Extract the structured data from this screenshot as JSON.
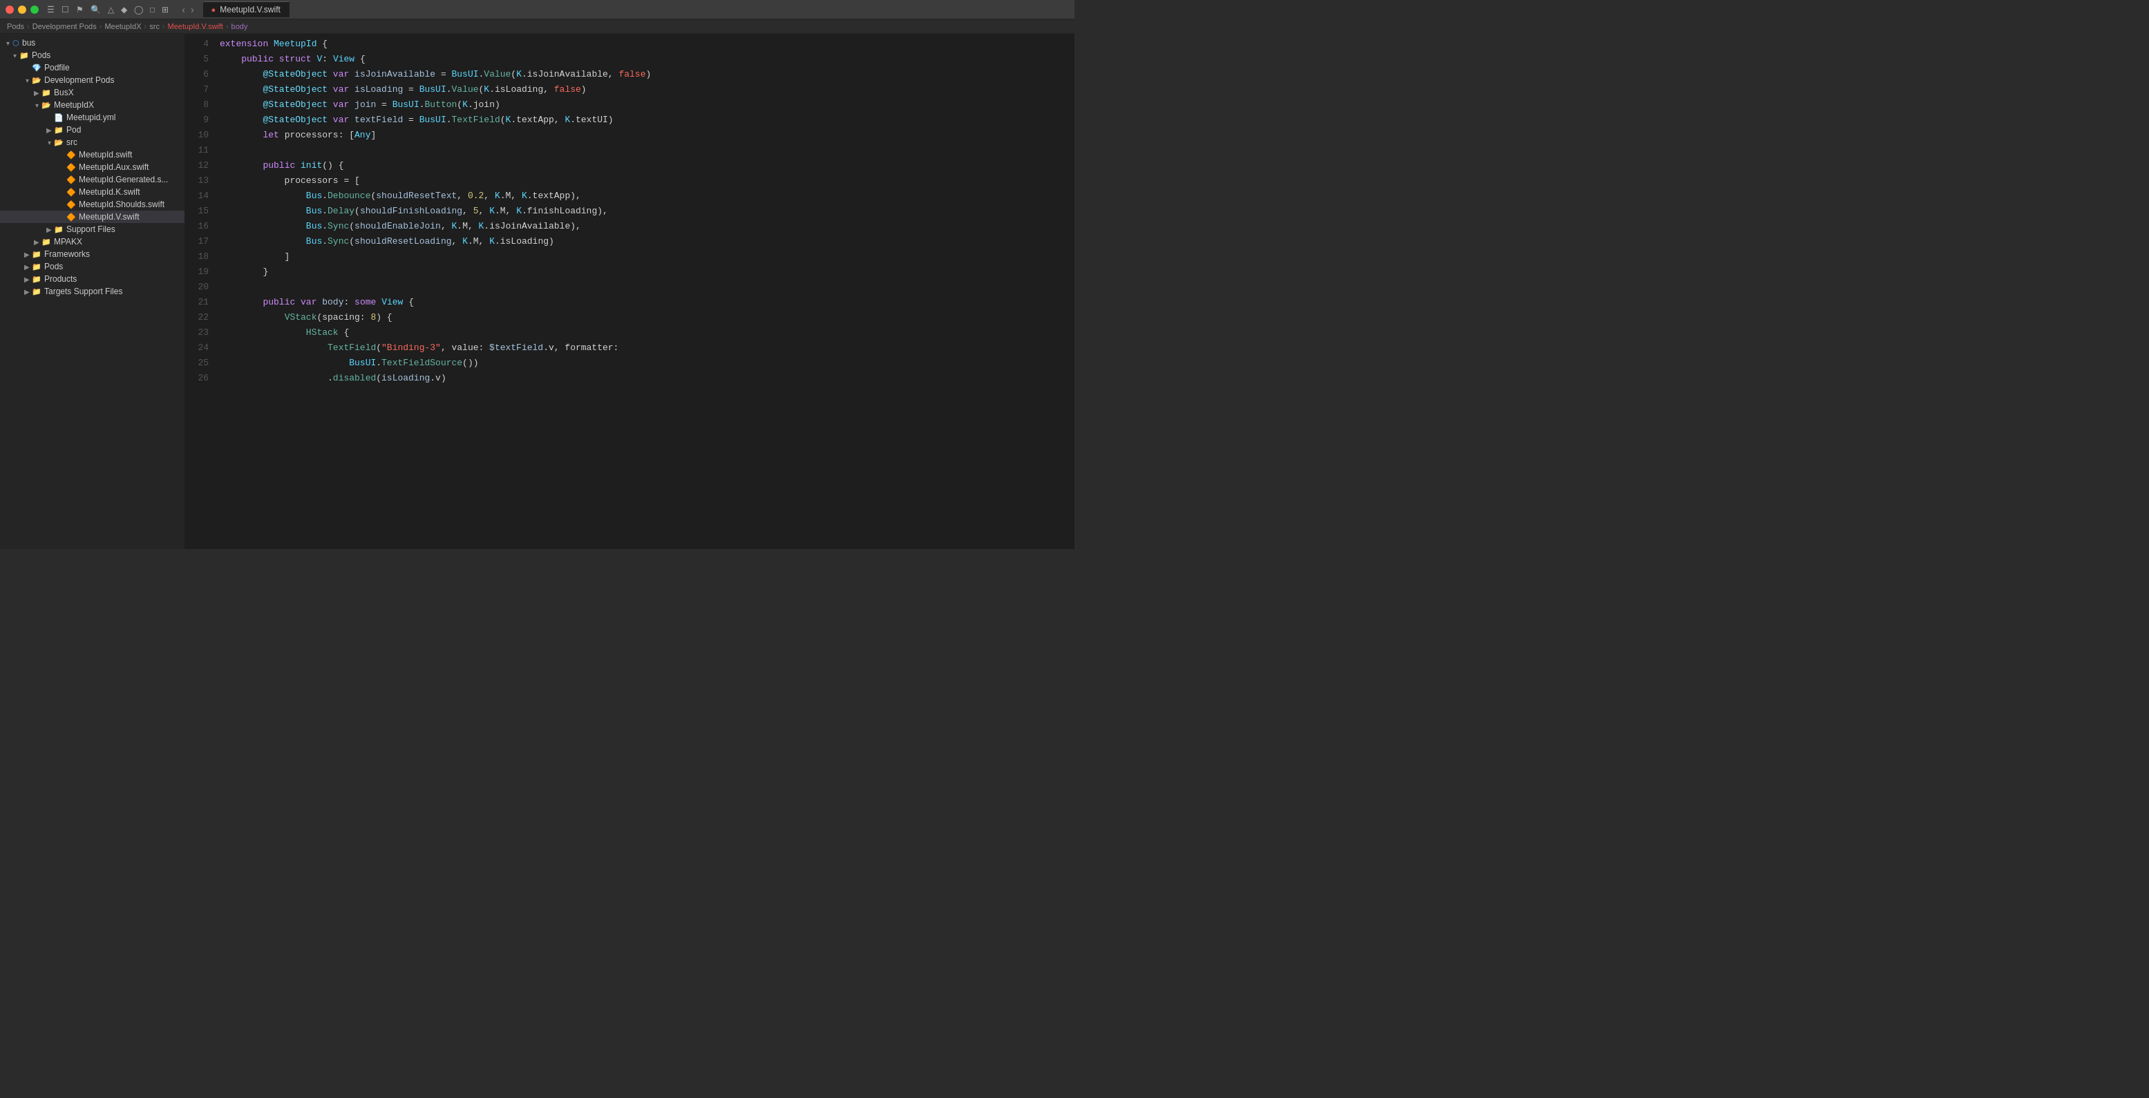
{
  "titlebar": {
    "tab_label": "MeetupId.V.swift",
    "traffic_lights": [
      "close",
      "minimize",
      "maximize"
    ]
  },
  "breadcrumb": {
    "items": [
      "Pods",
      "Development Pods",
      "MeetupIdX",
      "src",
      "MeetupId.V.swift",
      "body"
    ]
  },
  "sidebar": {
    "items": [
      {
        "id": "bus",
        "label": "bus",
        "indent": 0,
        "type": "project",
        "icon": "project",
        "expanded": true
      },
      {
        "id": "pods",
        "label": "Pods",
        "indent": 1,
        "type": "group",
        "icon": "folder-blue",
        "expanded": true
      },
      {
        "id": "podfile",
        "label": "Podfile",
        "indent": 2,
        "type": "file",
        "icon": "ruby"
      },
      {
        "id": "devpods",
        "label": "Development Pods",
        "indent": 2,
        "type": "group",
        "icon": "folder",
        "expanded": true
      },
      {
        "id": "busx",
        "label": "BusX",
        "indent": 3,
        "type": "group",
        "icon": "folder",
        "expanded": false
      },
      {
        "id": "meetupidx",
        "label": "MeetupIdX",
        "indent": 3,
        "type": "group",
        "icon": "folder",
        "expanded": true
      },
      {
        "id": "meetupidyml",
        "label": "Meetupid.yml",
        "indent": 4,
        "type": "file",
        "icon": "yaml"
      },
      {
        "id": "pod",
        "label": "Pod",
        "indent": 4,
        "type": "group",
        "icon": "folder",
        "expanded": false
      },
      {
        "id": "src",
        "label": "src",
        "indent": 4,
        "type": "group",
        "icon": "folder",
        "expanded": true
      },
      {
        "id": "meetupid-swift",
        "label": "MeetupId.swift",
        "indent": 5,
        "type": "swift",
        "icon": "swift"
      },
      {
        "id": "meetupid-aux",
        "label": "MeetupId.Aux.swift",
        "indent": 5,
        "type": "swift",
        "icon": "swift"
      },
      {
        "id": "meetupid-gen",
        "label": "MeetupId.Generated.s...",
        "indent": 5,
        "type": "swift",
        "icon": "swift"
      },
      {
        "id": "meetupid-k",
        "label": "MeetupId.K.swift",
        "indent": 5,
        "type": "swift",
        "icon": "swift"
      },
      {
        "id": "meetupid-shoulds",
        "label": "MeetupId.Shoulds.swift",
        "indent": 5,
        "type": "swift",
        "icon": "swift"
      },
      {
        "id": "meetupid-v",
        "label": "MeetupId.V.swift",
        "indent": 5,
        "type": "swift",
        "icon": "swift",
        "selected": true
      },
      {
        "id": "support-files",
        "label": "Support Files",
        "indent": 4,
        "type": "group",
        "icon": "folder",
        "expanded": false
      },
      {
        "id": "mpakx",
        "label": "MPAKX",
        "indent": 3,
        "type": "group",
        "icon": "folder",
        "expanded": false
      },
      {
        "id": "frameworks",
        "label": "Frameworks",
        "indent": 2,
        "type": "group",
        "icon": "folder",
        "expanded": false
      },
      {
        "id": "pods-group",
        "label": "Pods",
        "indent": 2,
        "type": "group",
        "icon": "folder",
        "expanded": false
      },
      {
        "id": "products",
        "label": "Products",
        "indent": 2,
        "type": "group",
        "icon": "folder",
        "expanded": false
      },
      {
        "id": "targets-support",
        "label": "Targets Support Files",
        "indent": 2,
        "type": "group",
        "icon": "folder",
        "expanded": false
      }
    ]
  },
  "editor": {
    "filename": "MeetupId.V.swift",
    "lines": [
      {
        "num": 4,
        "code": "extension MeetupId {"
      },
      {
        "num": 5,
        "code": "    public struct V: View {"
      },
      {
        "num": 6,
        "code": "        @StateObject var isJoinAvailable = BusUI.Value(K.isJoinAvailable, false)"
      },
      {
        "num": 7,
        "code": "        @StateObject var isLoading = BusUI.Value(K.isLoading, false)"
      },
      {
        "num": 8,
        "code": "        @StateObject var join = BusUI.Button(K.join)"
      },
      {
        "num": 9,
        "code": "        @StateObject var textField = BusUI.TextField(K.textApp, K.textUI)"
      },
      {
        "num": 10,
        "code": "        let processors: [Any]"
      },
      {
        "num": 11,
        "code": ""
      },
      {
        "num": 12,
        "code": "        public init() {"
      },
      {
        "num": 13,
        "code": "            processors = ["
      },
      {
        "num": 14,
        "code": "                Bus.Debounce(shouldResetText, 0.2, K.M, K.textApp),"
      },
      {
        "num": 15,
        "code": "                Bus.Delay(shouldFinishLoading, 5, K.M, K.finishLoading),"
      },
      {
        "num": 16,
        "code": "                Bus.Sync(shouldEnableJoin, K.M, K.isJoinAvailable),"
      },
      {
        "num": 17,
        "code": "                Bus.Sync(shouldResetLoading, K.M, K.isLoading)"
      },
      {
        "num": 18,
        "code": "            ]"
      },
      {
        "num": 19,
        "code": "        }"
      },
      {
        "num": 20,
        "code": ""
      },
      {
        "num": 21,
        "code": "        public var body: some View {"
      },
      {
        "num": 22,
        "code": "            VStack(spacing: 8) {"
      },
      {
        "num": 23,
        "code": "                HStack {"
      },
      {
        "num": 24,
        "code": "                    TextField(\"Binding-3\", value: $textField.v, formatter:"
      },
      {
        "num": 25,
        "code": "                        BusUI.TextFieldSource())"
      },
      {
        "num": 26,
        "code": "                    .disabled(isLoading.v)"
      }
    ]
  }
}
